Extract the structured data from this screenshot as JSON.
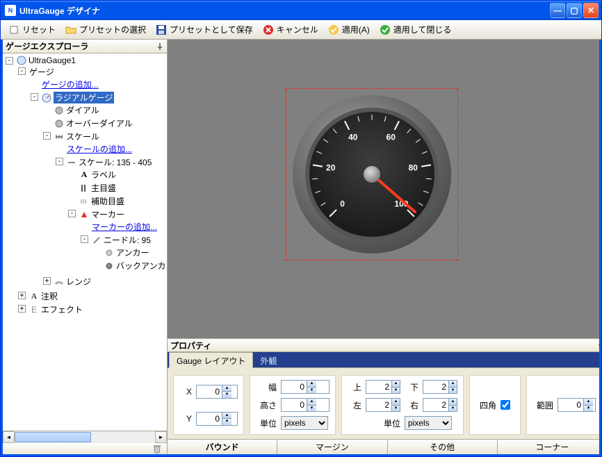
{
  "titlebar": {
    "title": "UltraGauge デザイナ"
  },
  "toolbar": {
    "reset": "リセット",
    "select_preset": "プリセットの選択",
    "save_preset": "プリセットとして保存",
    "cancel": "キャンセル",
    "apply": "適用(A)",
    "apply_close": "適用して閉じる"
  },
  "explorer": {
    "title": "ゲージエクスプローラ",
    "root": "UltraGauge1",
    "gauge_group": "ゲージ",
    "add_gauge": "ゲージの追加...",
    "radial_gauge": "ラジアルゲージ",
    "dial": "ダイアル",
    "overdial": "オーバーダイアル",
    "scale_group": "スケール",
    "add_scale": "スケールの追加...",
    "scale_item": "スケール: 135 - 405",
    "label": "ラベル",
    "major": "主目盛",
    "minor": "補助目盛",
    "marker_group": "マーカー",
    "add_marker": "マーカーの追加...",
    "needle": "ニードル: 95",
    "anchor": "アンカー",
    "back_anchor": "バックアンカ",
    "range": "レンジ",
    "annotation": "注釈",
    "effect": "エフェクト"
  },
  "gauge": {
    "ticks": [
      "0",
      "20",
      "40",
      "60",
      "80",
      "100"
    ]
  },
  "property": {
    "title": "プロパティ",
    "tab_layout": "Gauge レイアウト",
    "tab_appearance": "外観",
    "x_label": "X",
    "x_value": "0",
    "y_label": "Y",
    "y_value": "0",
    "width_label": "幅",
    "width_value": "0",
    "height_label": "高さ",
    "height_value": "0",
    "unit_label": "単位",
    "unit_value": "pixels",
    "top_label": "上",
    "top_value": "2",
    "bottom_label": "下",
    "bottom_value": "2",
    "left_label": "左",
    "left_value": "2",
    "right_label": "右",
    "right_value": "2",
    "unit2_label": "単位",
    "unit2_value": "pixels",
    "square_label": "四角",
    "extent_label": "範囲",
    "extent_value": "0"
  },
  "bottom_tabs": {
    "bound": "バウンド",
    "margin": "マージン",
    "other": "その他",
    "corner": "コーナー"
  }
}
